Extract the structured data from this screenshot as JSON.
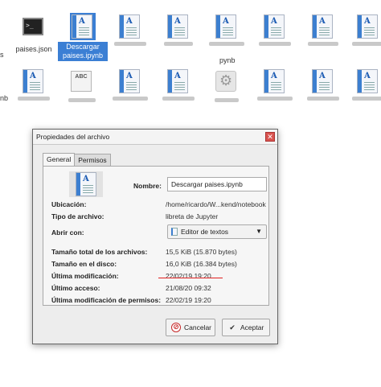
{
  "files_row1": [
    {
      "label": "paises.json",
      "icon": "terminal-icon"
    },
    {
      "label": "Descargar paises.ipynb",
      "icon": "document-icon",
      "selected": true
    },
    {
      "label": "",
      "icon": "document-icon"
    },
    {
      "label": "",
      "icon": "document-icon"
    },
    {
      "label": "",
      "icon": "document-icon"
    },
    {
      "label": "",
      "icon": "document-icon"
    },
    {
      "label": "",
      "icon": "document-icon"
    },
    {
      "label": "",
      "icon": "document-icon"
    }
  ],
  "edge_labels": {
    "s": "s",
    "pynb": "pynb",
    "nb": "nb"
  },
  "dialog": {
    "title": "Propiedades del archivo",
    "close": "✕",
    "tabs": {
      "general": "General",
      "permisos": "Permisos"
    },
    "fields": {
      "nombre_label": "Nombre:",
      "nombre_value": "Descargar paises.ipynb",
      "ubicacion_label": "Ubicación:",
      "ubicacion_value": "/home/ricardo/W...kend/notebook",
      "tipo_label": "Tipo de archivo:",
      "tipo_value": "libreta de Jupyter",
      "abrir_label": "Abrir con:",
      "abrir_value": "Editor de textos",
      "tamano_total_label": "Tamaño total de los archivos:",
      "tamano_total_value": "15,5 KiB (15.870 bytes)",
      "tamano_disco_label": "Tamaño en el disco:",
      "tamano_disco_value": "16,0 KiB (16.384 bytes)",
      "ultima_mod_label": "Última modificación:",
      "ultima_mod_value": "22/02/19 19:20",
      "ultimo_acceso_label": "Último acceso:",
      "ultimo_acceso_value": "21/08/20 09:32",
      "ultima_mod_perm_label": "Última modificación de permisos:",
      "ultima_mod_perm_value": "22/02/19 19:20"
    },
    "buttons": {
      "cancel": "Cancelar",
      "accept": "Aceptar"
    }
  },
  "colors": {
    "selection": "#3b7fd4",
    "underline": "#e02020",
    "close": "#d9534f"
  }
}
